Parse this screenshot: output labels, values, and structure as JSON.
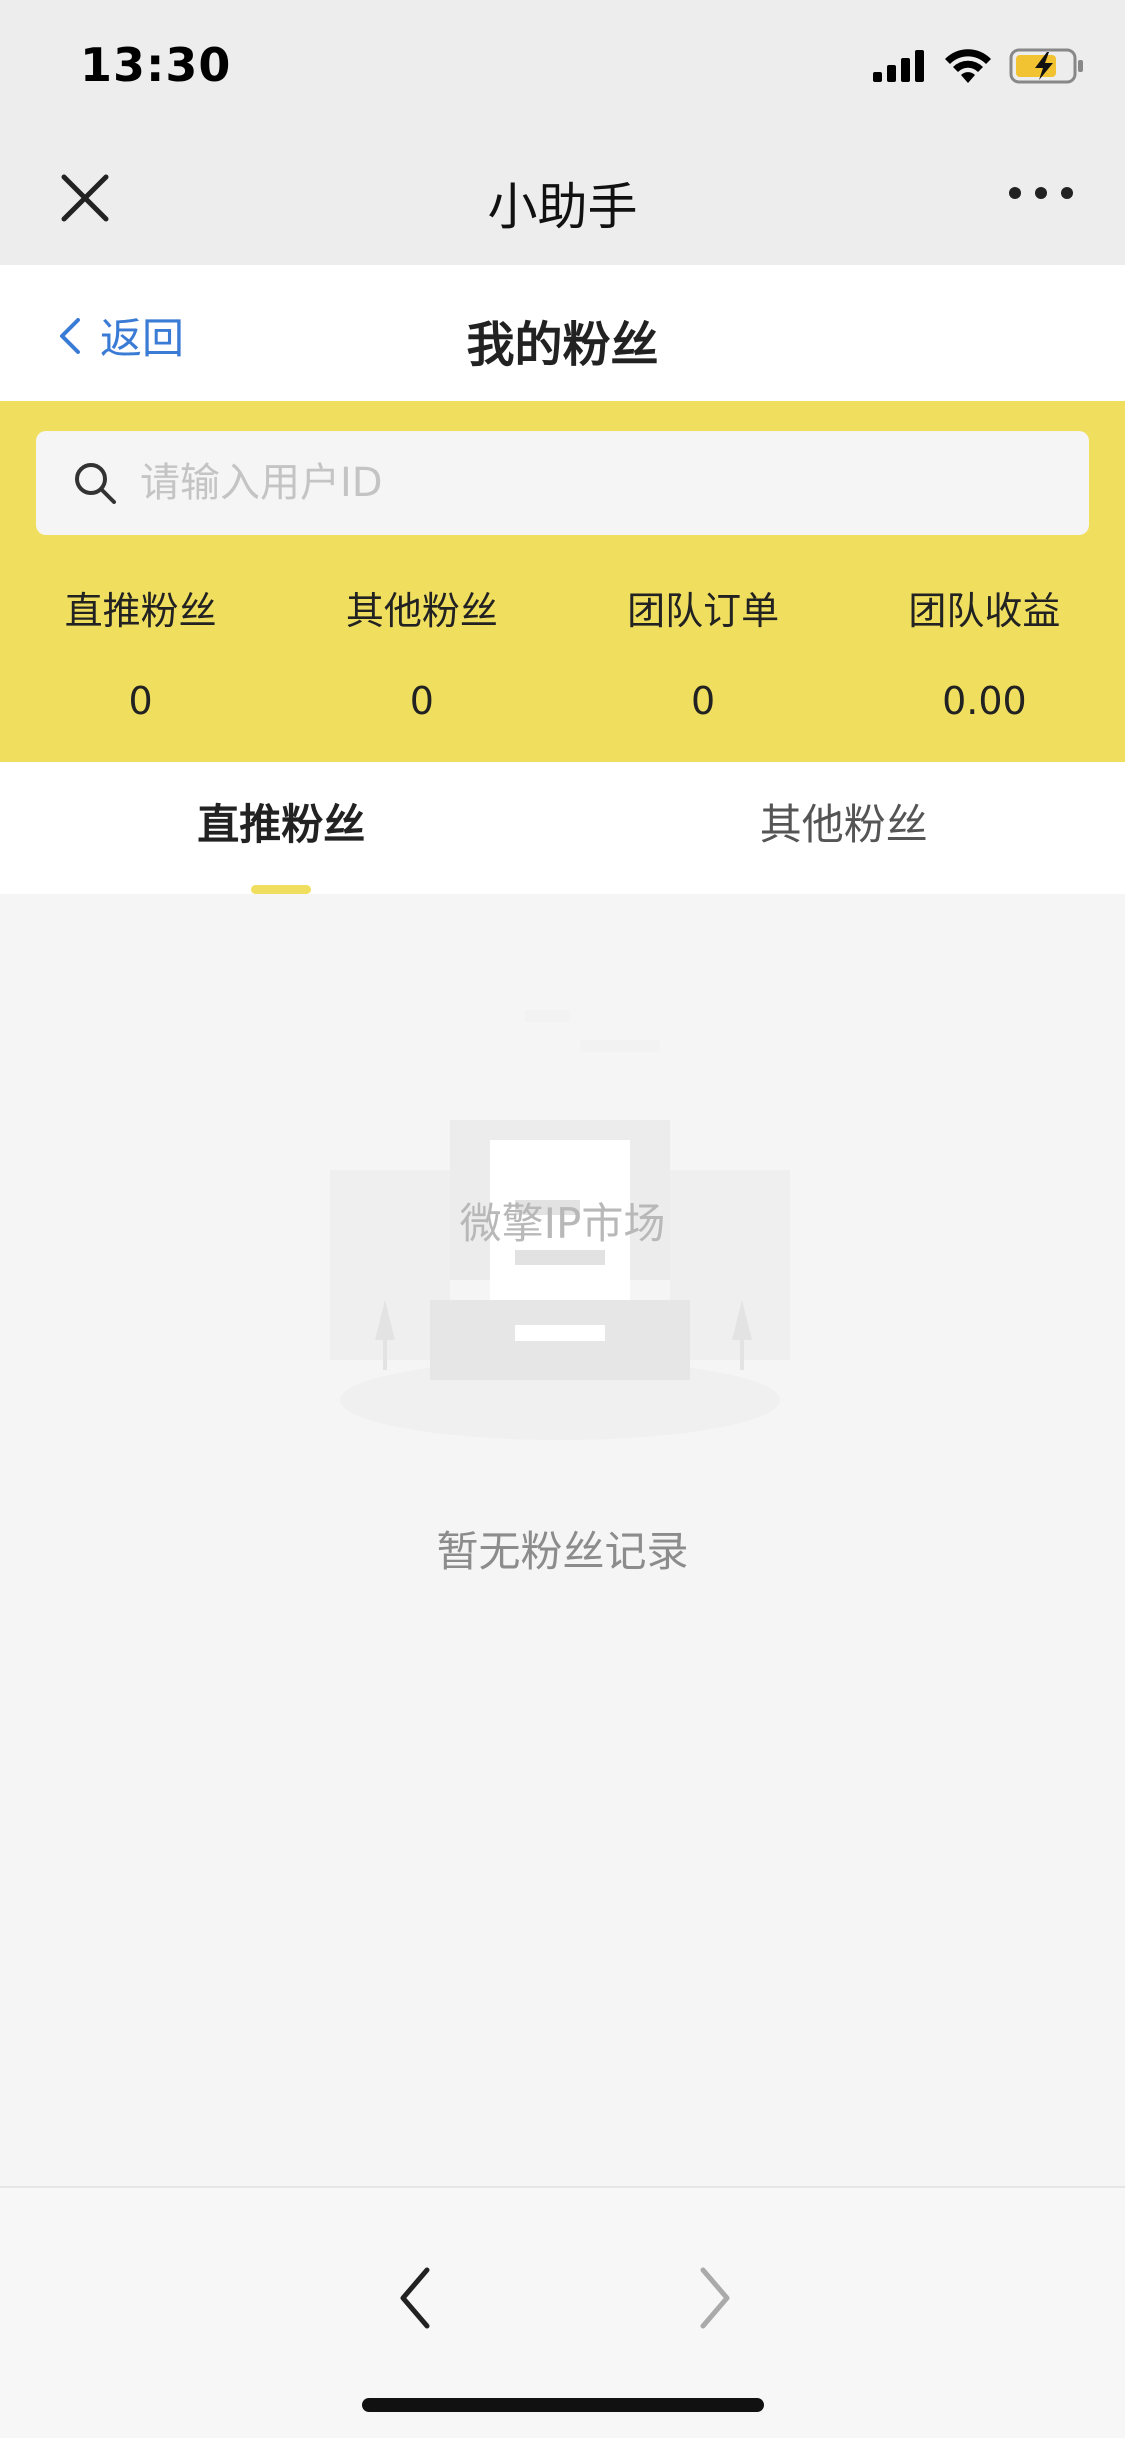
{
  "status_bar": {
    "time": "13:30",
    "icons": [
      "signal-icon",
      "wifi-icon",
      "battery-charging-icon"
    ]
  },
  "mini_program": {
    "title": "小助手",
    "close_icon": "close-icon",
    "more_icon": "more-icon"
  },
  "header": {
    "back_label": "返回",
    "title": "我的粉丝"
  },
  "search": {
    "placeholder": "请输入用户ID",
    "value": ""
  },
  "stats": [
    {
      "label": "直推粉丝",
      "value": "0"
    },
    {
      "label": "其他粉丝",
      "value": "0"
    },
    {
      "label": "团队订单",
      "value": "0"
    },
    {
      "label": "团队收益",
      "value": "0.00"
    }
  ],
  "tabs": [
    {
      "label": "直推粉丝",
      "active": true
    },
    {
      "label": "其他粉丝",
      "active": false
    }
  ],
  "empty_state": {
    "watermark": "微擎IP市场",
    "message": "暂无粉丝记录"
  },
  "colors": {
    "accent_yellow": "#f0df5f",
    "link_blue": "#3a7bd5",
    "background": "#f5f5f5"
  }
}
